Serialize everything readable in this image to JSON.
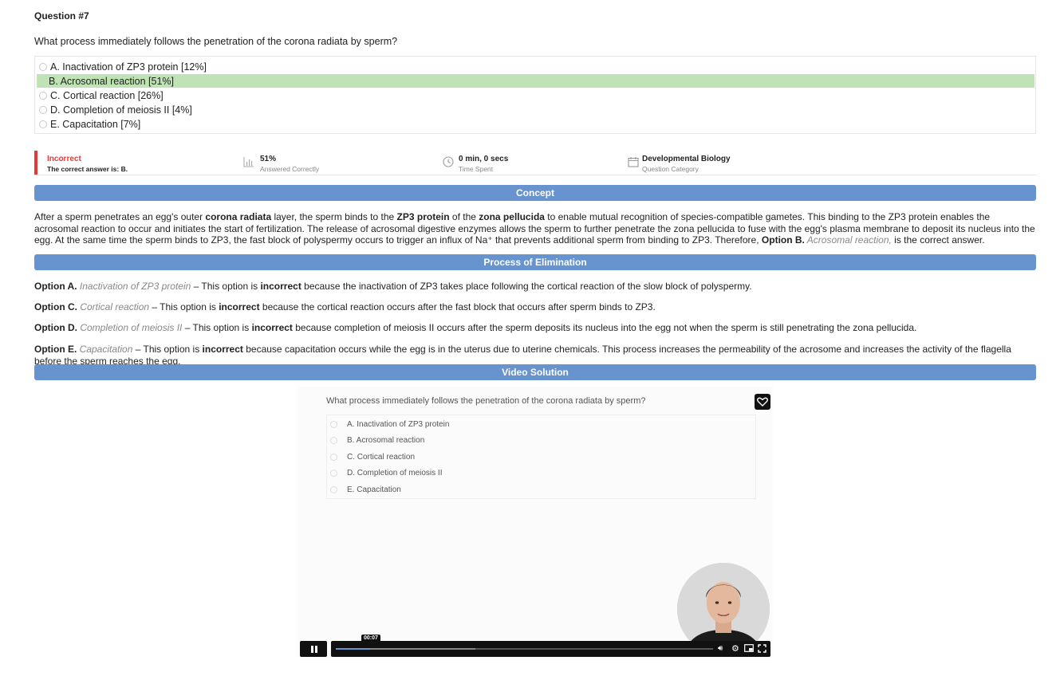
{
  "question": {
    "number_label": "Question #7",
    "text": "What process immediately follows the penetration of the corona radiata by sperm?",
    "options": [
      {
        "label": "A. Inactivation of ZP3 protein [12%]",
        "correct": false
      },
      {
        "label": "B. Acrosomal reaction [51%]",
        "correct": true
      },
      {
        "label": "C. Cortical reaction [26%]",
        "correct": false
      },
      {
        "label": "D. Completion of meiosis II [4%]",
        "correct": false
      },
      {
        "label": "E. Capacitation [7%]",
        "correct": false
      }
    ]
  },
  "stats": {
    "result": "Incorrect",
    "correct_answer": "The correct answer is: B.",
    "percent": "51%",
    "percent_label": "Answered Correctly",
    "time": "0 min, 0 secs",
    "time_label": "Time Spent",
    "category": "Developmental Biology",
    "category_label": "Question Category"
  },
  "sections": {
    "concept": "Concept",
    "elimination": "Process of Elimination",
    "video": "Video Solution"
  },
  "concept": {
    "t1": "After a sperm penetrates an egg's outer ",
    "b1": "corona radiata",
    "t2": " layer, the sperm binds to the ",
    "b2": "ZP3 protein",
    "t3": " of the ",
    "b3": "zona pellucida",
    "t4": " to enable mutual recognition of species-compatible gametes. This binding to the ZP3 protein enables the acrosomal reaction to occur and initiates the start of fertilization. The release of acrosomal digestive enzymes allows the sperm to further penetrate the zona pellucida to fuse with the egg's plasma membrane to deposit its nucleus into the egg. At the same time the sperm binds to ZP3, the fast block of polyspermy occurs to trigger an influx of Na⁺ that prevents additional sperm from binding to ZP3. Therefore, ",
    "b4": "Option B.",
    "i1": " Acrosomal reaction,",
    "t5": " is the correct answer."
  },
  "elimination": [
    {
      "option": "Option A.",
      "name": " Inactivation of ZP3 protein",
      "pre": " – This option is ",
      "bold": "incorrect",
      "post": " because the inactivation of ZP3 takes place following the cortical reaction of the slow block of polyspermy."
    },
    {
      "option": "Option C.",
      "name": " Cortical reaction",
      "pre": " – This option is ",
      "bold": "incorrect",
      "post": " because the cortical reaction occurs after the fast block that occurs after sperm binds to ZP3."
    },
    {
      "option": "Option D.",
      "name": " Completion of meiosis II",
      "pre": " – This option is ",
      "bold": "incorrect",
      "post": " because completion of meiosis II occurs after the sperm deposits its nucleus into the egg not when the sperm is still penetrating the zona pellucida."
    },
    {
      "option": "Option E.",
      "name": " Capacitation",
      "pre": " – This option is ",
      "bold": "incorrect",
      "post": " because capacitation occurs while the egg is in the uterus due to uterine chemicals. This process increases the permeability of the acrosome and increases the activity of the flagella before the sperm reaches the egg."
    }
  ],
  "video": {
    "question": "What process immediately follows the penetration of the corona radiata by sperm?",
    "options": [
      "A. Inactivation of ZP3 protein",
      "B. Acrosomal reaction",
      "C. Cortical reaction",
      "D. Completion of meiosis II",
      "E. Capacitation"
    ],
    "current_time": "00:07",
    "progress_fraction": 0.09,
    "buffered_fraction": 0.37
  }
}
